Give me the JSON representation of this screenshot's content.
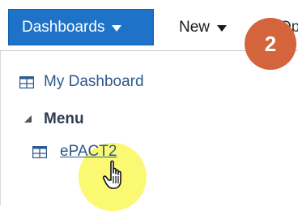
{
  "menubar": {
    "dashboards_label": "Dashboards",
    "new_label": "New",
    "truncated_label": "Op"
  },
  "step_badge": "2",
  "panel": {
    "my_dashboard_label": "My Dashboard",
    "menu_heading": "Menu",
    "epact_label": "ePACT2"
  },
  "icons": {
    "dashboard": "dashboard-grid-icon",
    "caret": "caret-down-icon",
    "expand": "expanded-triangle-icon",
    "cursor": "hand-pointer-cursor"
  },
  "colors": {
    "accent": "#1e73c8",
    "link": "#2d5a8a",
    "badge": "#d4643c",
    "highlight": "#faf53c"
  }
}
